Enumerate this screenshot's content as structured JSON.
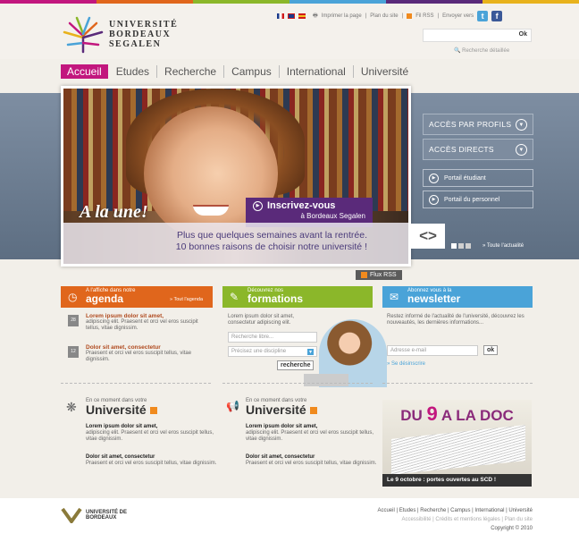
{
  "colors": {
    "purple": "#c2177e",
    "orange": "#e0661c",
    "green": "#8bb72a",
    "blue": "#4aa3d8",
    "violet": "#5a2a7a",
    "slate": "#7d8c9f"
  },
  "header": {
    "logo_lines": [
      "UNIVERSITÉ",
      "BORDEAUX",
      "SEGALEN"
    ],
    "toplinks": [
      "Imprimer la page",
      "Plan du site",
      "Fil RSS",
      "Envoyer vers"
    ],
    "search_button": "Ok",
    "search_advanced": "Recherche détaillée",
    "social": [
      "t",
      "f"
    ]
  },
  "nav": [
    "Accueil",
    "Etudes",
    "Recherche",
    "Campus",
    "International",
    "Université"
  ],
  "hero": {
    "alaune": "A la une!",
    "cta_title": "Inscrivez-vous",
    "cta_sub": "à Bordeaux Segalen",
    "tagline_1": "Plus que quelques semaines avant la rentrée.",
    "tagline_2": "10 bonnes raisons de choisir notre université !",
    "arrows": "<>",
    "toute": "» Toute l'actualité"
  },
  "side": {
    "profils": "ACCÈS PAR PROFILS",
    "directs": "ACCÈS DIRECTS",
    "portail_etudiant": "Portail étudiant",
    "portail_perso": "Portail du personnel"
  },
  "rss": "Flux RSS",
  "agenda": {
    "small": "A l'affiche dans notre",
    "big": "agenda",
    "link": "» Tout l'agenda",
    "items": [
      {
        "title": "Lorem ipsum dolor sit amet,",
        "text": "adipiscing elit. Praesent et orci vel eros suscipit tellus, vitae dignissim."
      },
      {
        "title": "Dolor sit amet, consectetur",
        "text": "Praesent et orci vel eros suscipit tellus, vitae dignissim."
      }
    ]
  },
  "formations": {
    "small": "Découvrez nos",
    "big": "formations",
    "intro": "Lorem ipsum dolor sit amet, consectetur adipiscing elit.",
    "free_placeholder": "Recherche libre...",
    "select": "Précisez une discipline",
    "button": "recherche"
  },
  "newsletter": {
    "small": "Abonnez vous à la",
    "big": "newsletter",
    "intro": "Restez informé de l'actualité de l'université, découvrez les nouveautés, les dernières informations...",
    "email_placeholder": "Adresse e-mail",
    "button": "ok",
    "unsubscribe": "» Se désinscrire"
  },
  "ce1": {
    "small": "En ce moment dans votre",
    "big": "Université",
    "items": [
      {
        "title": "Lorem ipsum dolor sit amet,",
        "text": "adipiscing elit. Praesent et orci vel eros suscipit tellus, vitae dignissim."
      },
      {
        "title": "Dolor sit amet, consectetur",
        "text": "Praesent et orci vel eros suscipit tellus, vitae dignissim."
      }
    ]
  },
  "ce2": {
    "small": "En ce moment dans votre",
    "big": "Université",
    "items": [
      {
        "title": "Lorem ipsum dolor sit amet,",
        "text": "adipiscing elit. Praesent et orci vel eros suscipit tellus, vitae dignissim."
      },
      {
        "title": "Dolor sit amet, consectetur",
        "text": "Praesent et orci vel eros suscipit tellus, vitae dignissim."
      }
    ]
  },
  "doc": {
    "pre": "DU ",
    "num": "9",
    "post": " A LA DOC",
    "caption": "Le 9 octobre : portes ouvertes au SCD !"
  },
  "footer": {
    "logo": [
      "UNIVERSITÉ DE",
      "BORDEAUX"
    ],
    "links": "Accueil | Etudes | Recherche | Campus | International | Université",
    "links2": "Accessibilité | Crédits et mentions légales | Plan du site",
    "copyright": "Copyright © 2010"
  }
}
